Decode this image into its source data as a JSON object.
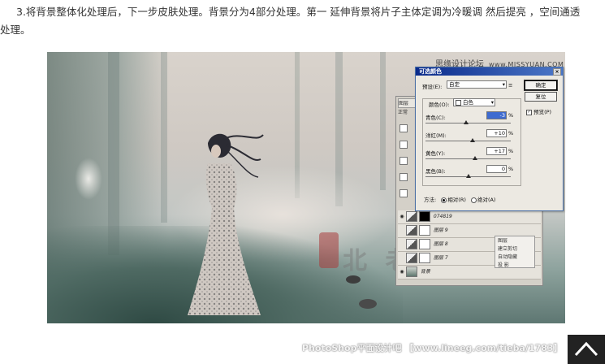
{
  "article": {
    "line1": "3.将背景整体化处理后，下一步皮肤处理。背景分为4部分处理。第一 延伸背景将片子主体定调为冷暖调 然后提亮 ，空间通透",
    "line2": "处理。"
  },
  "image": {
    "watermark_top_cn": "思缘设计论坛",
    "watermark_top_en": "www.MISSYUAN.COM",
    "stamp_text": "北 老 匠"
  },
  "dialog": {
    "title": "可选颜色",
    "close": "×",
    "preset_label": "预设(E):",
    "preset_value": "自定",
    "colors_label": "颜色(O):",
    "colors_value": "白色",
    "sliders": [
      {
        "label": "青色(C):",
        "value": "-3",
        "unit": "%",
        "level": 0.48
      },
      {
        "label": "洋红(M):",
        "value": "+10",
        "unit": "%",
        "level": 0.55
      },
      {
        "label": "黄色(Y):",
        "value": "+17",
        "unit": "%",
        "level": 0.58
      },
      {
        "label": "黑色(B):",
        "value": "0",
        "unit": "%",
        "level": 0.5
      }
    ],
    "ok": "确定",
    "reset": "复位",
    "preview_label": "预览(P)",
    "method_label": "方法:",
    "method_relative": "相对(R)",
    "method_absolute": "绝对(A)"
  },
  "layers": {
    "tab": "图层",
    "mode": "正常",
    "rows": [
      {
        "name": "074819"
      },
      {
        "name": "图层 9"
      },
      {
        "name": "图层 8"
      },
      {
        "name": "图层 7"
      },
      {
        "name": "背景"
      }
    ],
    "menu": [
      "图层",
      "建立剪切",
      "自动隐藏",
      "投 影"
    ]
  },
  "footer": {
    "watermark": "PhotoShop平面设计吧 【www.lineeg.com/tieba/1783】"
  }
}
